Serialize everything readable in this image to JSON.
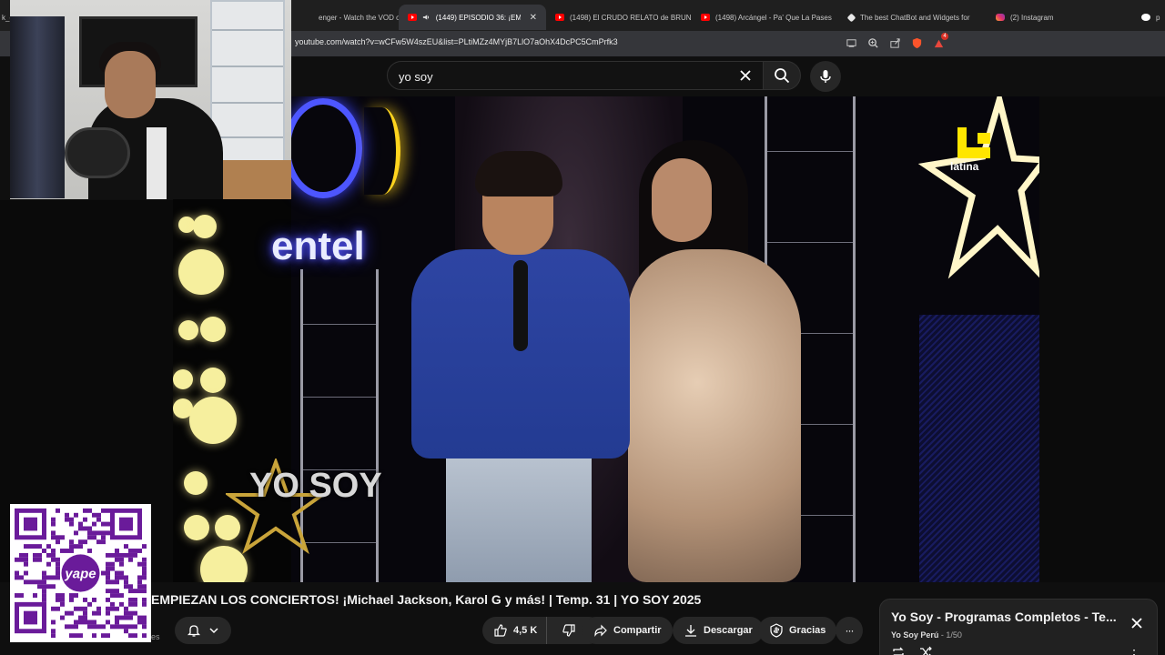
{
  "browser": {
    "tabs": [
      {
        "label": "k_c",
        "icon": "none",
        "active": false
      },
      {
        "label": "enger - Watch the VOD on Kic",
        "icon": "none",
        "active": false
      },
      {
        "label": "(1449) EPISODIO 36: ¡EMPIE",
        "icon": "youtube-icon",
        "active": true,
        "audio": true
      },
      {
        "label": "(1498) El CRUDO RELATO de BRUN",
        "icon": "youtube-icon",
        "active": false
      },
      {
        "label": "(1498) Arcángel - Pa' Que La Pases",
        "icon": "youtube-icon",
        "active": false
      },
      {
        "label": "The best ChatBot and Widgets for",
        "icon": "diamond-icon",
        "active": false
      },
      {
        "label": "(2) Instagram",
        "icon": "instagram-icon",
        "active": false
      },
      {
        "label": "p",
        "icon": "google-icon",
        "active": false
      }
    ],
    "url": "youtube.com/watch?v=wCFw5W4szEU&list=PLtiMZz4MYjB7LlO7aOhX4DcPC5CmPrfk3",
    "extension_badge": "4"
  },
  "youtube": {
    "search": {
      "value": "yo soy"
    },
    "video": {
      "overlay_logo_text": "entel",
      "channel_bug_text": "latina",
      "show_logo_text": "YO SOY"
    },
    "title": "EMPIEZAN LOS CONCIERTOS! ¡Michael Jackson, Karol G y más! | Temp. 31 | YO SOY 2025",
    "subscribers_fragment": "es",
    "actions": {
      "likes": "4,5 K",
      "share": "Compartir",
      "download": "Descargar",
      "thanks": "Gracias",
      "more": "···"
    },
    "playlist": {
      "title": "Yo Soy - Programas Completos - Te...",
      "channel": "Yo Soy Perú",
      "position": "1/50"
    }
  },
  "overlays": {
    "qr_brand": "yape"
  }
}
